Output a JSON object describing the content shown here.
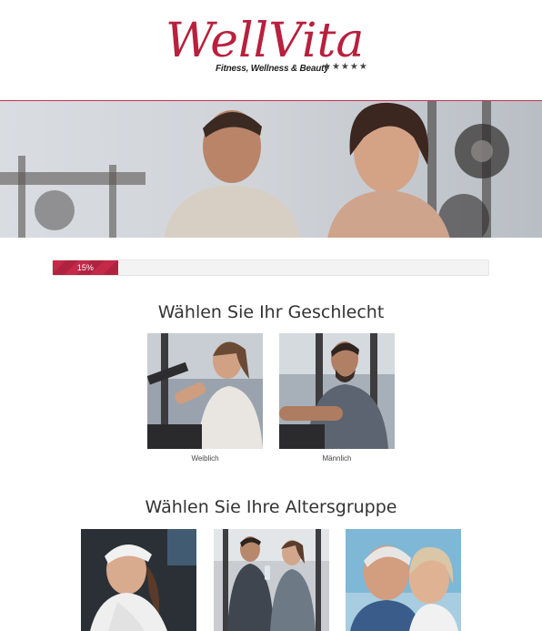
{
  "brand": {
    "logo_text": "WellVita",
    "tagline": "Fitness, Wellness & Beauty",
    "stars": "★★★★★",
    "accent_color": "#b8203d"
  },
  "hero": {
    "image": "gym-couple-photo"
  },
  "progress": {
    "label": "15%",
    "fraction": 0.15
  },
  "gender_section": {
    "title": "Wählen Sie Ihr Geschlecht",
    "options": [
      {
        "label": "Weiblich",
        "image": "woman-training-photo"
      },
      {
        "label": "Männlich",
        "image": "man-training-photo"
      }
    ]
  },
  "age_section": {
    "title": "Wählen Sie Ihre Altersgruppe",
    "options": [
      {
        "image": "young-woman-photo"
      },
      {
        "image": "couple-gym-photo"
      },
      {
        "image": "senior-couple-photo"
      }
    ]
  }
}
